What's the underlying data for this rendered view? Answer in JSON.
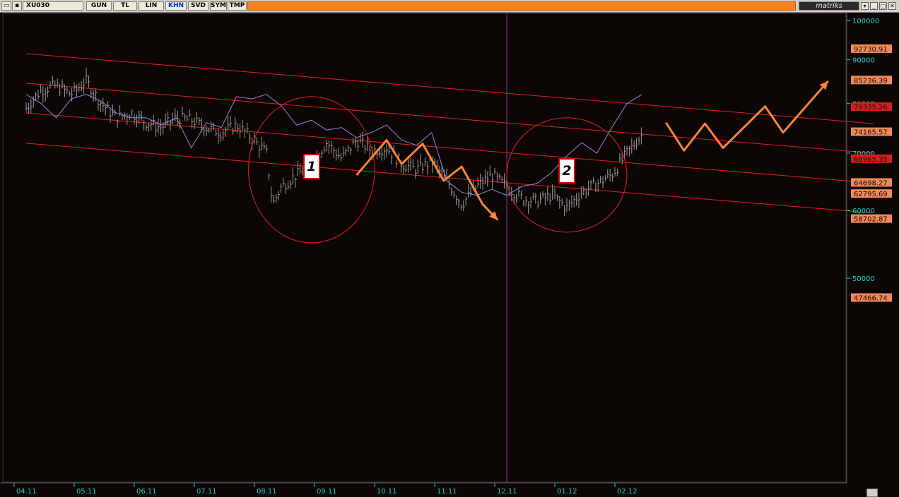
{
  "toolbar": {
    "symbol": "XU030",
    "buttons": [
      "GUN",
      "TL",
      "LIN",
      "KHN",
      "SVD",
      "SYM",
      "TMP"
    ],
    "active_button": "KHN",
    "brand": "matriks",
    "window_controls": [
      "▾",
      "_",
      "□",
      "✕"
    ]
  },
  "colors": {
    "price": "#9a9a9a",
    "overlay": "#8a8ad8",
    "channel": "#e61e1e",
    "projection": "#f5843c",
    "axis_text": "#20d0d0",
    "label_bg_orange": "#f0885a",
    "label_bg_red": "#d41e1e",
    "divider": "#9a2aa8"
  },
  "chart_data": {
    "type": "line",
    "title": "",
    "xlabel": "",
    "ylabel": "",
    "x_ticks": [
      "04.11",
      "05.11",
      "06.11",
      "07.11",
      "08.11",
      "09.11",
      "10.11",
      "11.11",
      "12.11",
      "01.12",
      "02.12"
    ],
    "y_scale": "log",
    "y_ticks": [
      100000,
      90000,
      80000,
      70000,
      60000,
      50000
    ],
    "ylim": [
      44000,
      102000
    ],
    "levels": [
      {
        "value": 92730.91,
        "label": "92730.91",
        "style": "orange"
      },
      {
        "value": 85236.39,
        "label": "85236.39",
        "style": "orange"
      },
      {
        "value": 79335.26,
        "label": "79335.26",
        "style": "red"
      },
      {
        "value": 74165.57,
        "label": "74165.57",
        "style": "orange"
      },
      {
        "value": 68965.35,
        "label": "68965.35",
        "style": "red"
      },
      {
        "value": 64698.27,
        "label": "64698.27",
        "style": "orange"
      },
      {
        "value": 62795.69,
        "label": "62795.69",
        "style": "orange"
      },
      {
        "value": 58702.87,
        "label": "58702.87",
        "style": "orange"
      },
      {
        "value": 47466.74,
        "label": "47466.74",
        "style": "orange"
      }
    ],
    "price_series": {
      "x": [
        0,
        0.25,
        0.5,
        0.75,
        1,
        1.25,
        1.5,
        1.75,
        2,
        2.25,
        2.5,
        2.75,
        3,
        3.25,
        3.5,
        3.75,
        4,
        4.1,
        4.25,
        4.5,
        4.75,
        5,
        5.25,
        5.5,
        5.75,
        6,
        6.25,
        6.5,
        6.75,
        7,
        7.25,
        7.5,
        7.75,
        8,
        8.25,
        8.5,
        8.75,
        9,
        9.25,
        9.5,
        9.75,
        10,
        10.25
      ],
      "y": [
        79000,
        83000,
        84000,
        82000,
        85000,
        80000,
        77000,
        78000,
        76000,
        75000,
        77000,
        76500,
        75000,
        74000,
        75500,
        73000,
        70000,
        61000,
        64000,
        66000,
        68000,
        72000,
        69000,
        72500,
        70500,
        71000,
        68000,
        67000,
        68500,
        65000,
        61000,
        64000,
        66000,
        64000,
        62000,
        61500,
        62500,
        60500,
        63000,
        64500,
        66000,
        70000,
        73500
      ]
    },
    "overlay_series": {
      "x": [
        0,
        0.25,
        0.5,
        0.75,
        1,
        1.25,
        1.5,
        1.75,
        2,
        2.25,
        2.5,
        2.75,
        3,
        3.25,
        3.5,
        3.75,
        4,
        4.25,
        4.5,
        4.75,
        5,
        5.25,
        5.5,
        5.75,
        6,
        6.25,
        6.5,
        6.75,
        7,
        7.25,
        7.5,
        7.75,
        8,
        8.25,
        8.5,
        8.75,
        9,
        9.25,
        9.5,
        9.75,
        10,
        10.25
      ],
      "y": [
        82000,
        80000,
        77000,
        81000,
        82000,
        80500,
        78000,
        77000,
        77000,
        75500,
        77000,
        71000,
        76000,
        75000,
        81500,
        81000,
        82000,
        79500,
        75500,
        76500,
        74500,
        75000,
        73000,
        74000,
        75500,
        72500,
        71500,
        74000,
        65000,
        63000,
        62500,
        63500,
        62500,
        64000,
        64500,
        66500,
        69500,
        72000,
        70000,
        75000,
        80000,
        82000
      ]
    },
    "channel_lines": [
      {
        "x": [
          0,
          14.1
        ],
        "y": [
          91500,
          75800
        ]
      },
      {
        "x": [
          0,
          14.1
        ],
        "y": [
          84500,
          70000
        ]
      },
      {
        "x": [
          0,
          14.1
        ],
        "y": [
          78000,
          64600
        ]
      },
      {
        "x": [
          0,
          14.1
        ],
        "y": [
          71900,
          59600
        ]
      }
    ],
    "projection_paths": [
      {
        "x": [
          5.5,
          6.0,
          6.25,
          6.6,
          6.95,
          7.25,
          7.6,
          7.85
        ],
        "y": [
          66000,
          72500,
          68000,
          71800,
          65000,
          67500,
          61000,
          58500
        ],
        "arrow": true
      },
      {
        "x": [
          10.65,
          10.95,
          11.3,
          11.6,
          12.3,
          12.6,
          13.35
        ],
        "y": [
          76000,
          70500,
          75800,
          71000,
          79400,
          74000,
          85000
        ],
        "arrow": true
      }
    ],
    "divider_x": 8.0,
    "annotations": [
      {
        "label": "1",
        "center": [
          4.75,
          67500
        ],
        "rx": 1.05,
        "ry_top": 81500,
        "ry_bottom": 55000
      },
      {
        "label": "2",
        "center": [
          9.0,
          66800
        ],
        "rx": 1.0,
        "ry_top": 77000,
        "ry_bottom": 56600
      }
    ]
  }
}
